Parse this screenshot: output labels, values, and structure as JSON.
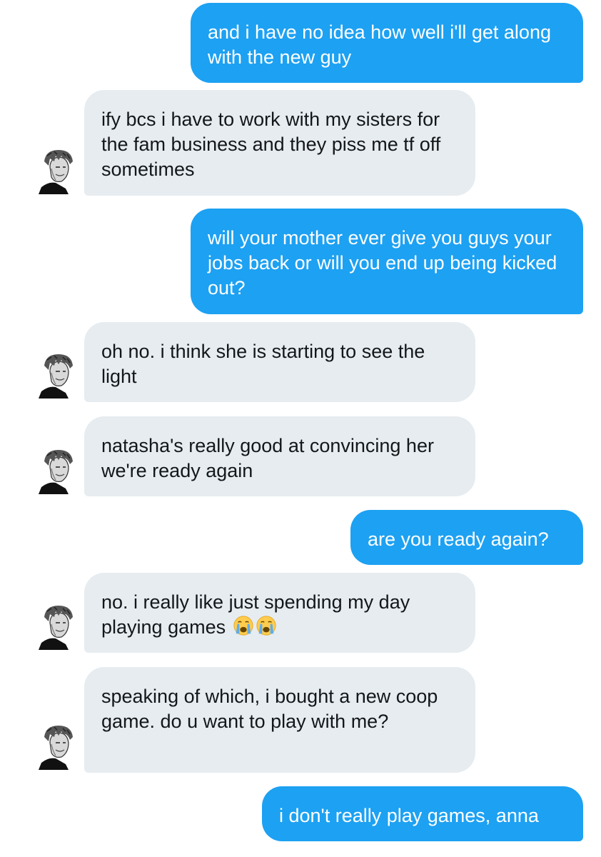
{
  "conversation": {
    "messages": [
      {
        "id": "m1",
        "sender": "me",
        "text": "and i have no idea how well i'll get along with the new guy"
      },
      {
        "id": "m2",
        "sender": "anna",
        "text": "ify bcs i have to work with my sisters for the fam business and they piss me tf off sometimes"
      },
      {
        "id": "m3",
        "sender": "me",
        "text": "will your mother ever give you guys your jobs back or will you end up being kicked out?"
      },
      {
        "id": "m4",
        "sender": "anna",
        "text": "oh no. i think she is starting to see the light"
      },
      {
        "id": "m5",
        "sender": "anna",
        "text": "natasha's really good at convincing her we're ready again"
      },
      {
        "id": "m6",
        "sender": "me",
        "text": "are you ready again?"
      },
      {
        "id": "m7",
        "sender": "anna",
        "text": "no. i really like just spending my day playing games",
        "emoji": [
          "crying-face-emoji",
          "crying-face-emoji"
        ]
      },
      {
        "id": "m8",
        "sender": "anna",
        "text": "speaking of which, i bought a new coop game. do u want to play with me?"
      },
      {
        "id": "m9",
        "sender": "me",
        "text": "i don't really play games, anna"
      }
    ]
  },
  "colors": {
    "sent_bubble": "#1da1f2",
    "received_bubble": "#e6ecf0",
    "sent_text": "#ffffff",
    "received_text": "#14171a"
  }
}
